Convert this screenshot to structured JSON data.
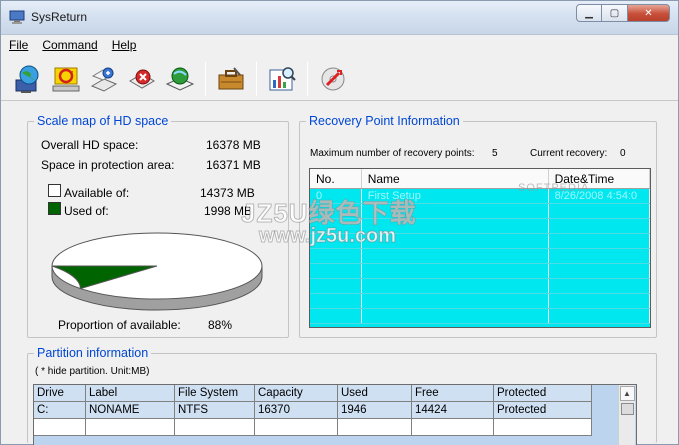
{
  "window": {
    "title": "SysReturn"
  },
  "menu": [
    {
      "label": "File"
    },
    {
      "label": "Command"
    },
    {
      "label": "Help"
    }
  ],
  "toolbar": {
    "buttons": [
      "globe-monitor-icon",
      "restore-computer-icon",
      "recovery-wizard-icon",
      "delete-recovery-icon",
      "restore-book-icon",
      "toolbox-icon",
      "chart-magnify-icon",
      "exit-cd-icon"
    ]
  },
  "scale_map": {
    "title": "Scale map of HD space",
    "overall_label": "Overall HD space:",
    "overall_value": "16378 MB",
    "protect_label": "Space in protection area:",
    "protect_value": "16371 MB",
    "available_label": "Available of:",
    "available_value": "14373 MB",
    "used_label": "Used of:",
    "used_value": "1998 MB",
    "proportion_label": "Proportion of available:",
    "proportion_value": "88%",
    "available_fraction": 0.88,
    "colors": {
      "available": "#ffffff",
      "used": "#006400"
    }
  },
  "recovery": {
    "title": "Recovery Point Information",
    "max_label": "Maximum number of recovery points:",
    "max_value": "5",
    "current_label": "Current recovery:",
    "current_value": "0",
    "columns": [
      "No.",
      "Name",
      "Date&Time"
    ],
    "rows": [
      {
        "no": "0",
        "name": "First Setup",
        "date": "8/26/2008 4:54:0"
      }
    ],
    "colors": {
      "background": "#00e7f0"
    }
  },
  "partition": {
    "title": "Partition information",
    "note": "( * hide partition.   Unit:MB)",
    "columns": [
      "Drive",
      "Label",
      "File System",
      "Capacity",
      "Used",
      "Free",
      "Protected"
    ],
    "rows": [
      [
        "C:",
        "NONAME",
        "NTFS",
        "16370",
        "1946",
        "14424",
        "Protected"
      ]
    ]
  },
  "watermark": {
    "line1": "JZ5U绿色下载",
    "line2": "www.jz5u.com",
    "line3": "SOFTPEDIA"
  }
}
